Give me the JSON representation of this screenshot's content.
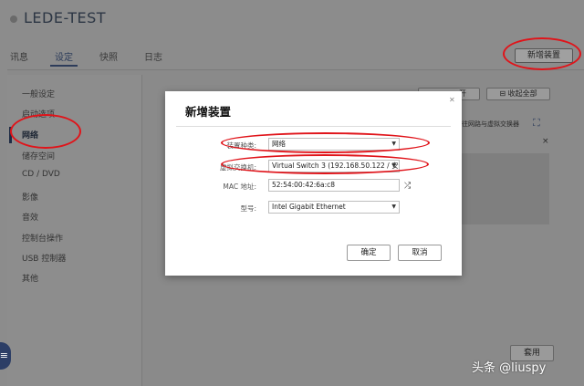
{
  "app": {
    "title": "LEDE-TEST"
  },
  "tabs": [
    {
      "label": "讯息"
    },
    {
      "label": "设定"
    },
    {
      "label": "快照"
    },
    {
      "label": "日志"
    }
  ],
  "header": {
    "add_device_label": "新增装置"
  },
  "sidebar": {
    "items": [
      {
        "label": "一般设定"
      },
      {
        "label": "启动选项"
      },
      {
        "label": "网络"
      },
      {
        "label": "储存空间"
      },
      {
        "label": "CD / DVD"
      },
      {
        "label": "影像"
      },
      {
        "label": "音效"
      },
      {
        "label": "控制台操作"
      },
      {
        "label": "USB 控制器"
      },
      {
        "label": "其他"
      }
    ]
  },
  "background": {
    "expand_label": "开",
    "collapse_all_label": "收起全部",
    "network_note": "往网路与虚拟交换器",
    "apply_label": "套用"
  },
  "dialog": {
    "title": "新增装置",
    "fields": {
      "device_type": {
        "label": "装置种类:",
        "value": "网络"
      },
      "virtual_switch": {
        "label": "虚拟交换机:",
        "value": "Virtual Switch 3 (192.168.50.122 / 安..."
      },
      "mac_address": {
        "label": "MAC 地址:",
        "value": "52:54:00:42:6a:c8"
      },
      "model": {
        "label": "型号:",
        "value": "Intel Gigabit Ethernet"
      }
    },
    "confirm_label": "确定",
    "cancel_label": "取消"
  },
  "watermark": "头条 @liuspy",
  "colors": {
    "annotation": "#e0141a",
    "accent": "#2c3e66"
  }
}
